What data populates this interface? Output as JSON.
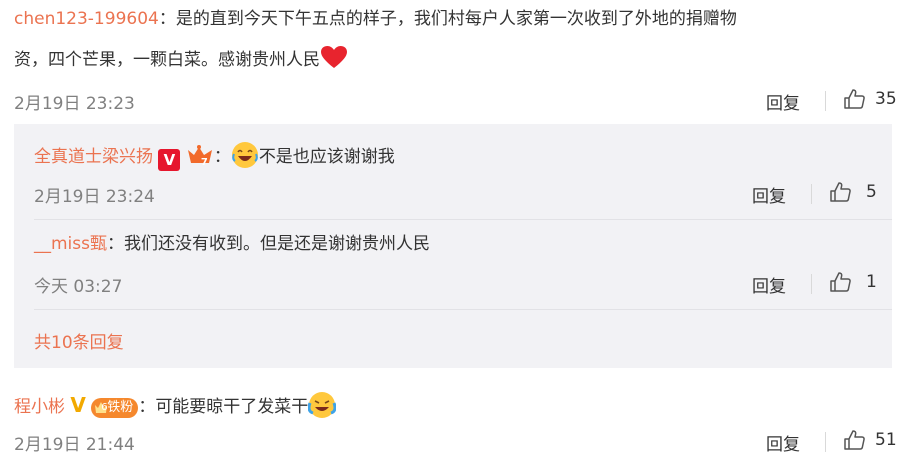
{
  "comments": [
    {
      "user": "chen123-199604",
      "separator": "：",
      "text_line1": "是的直到今天下午五点的样子，我们村每户人家第一次收到了外地的捐赠物",
      "text_line2": "资，四个芒果，一颗白菜。感谢贵州人民",
      "time": "2月19日 23:23",
      "reply_label": "回复",
      "likes": "35"
    },
    {
      "user": "程小彬",
      "separator": "：",
      "text": "可能要晾干了发菜干",
      "badge_level": "6",
      "badge_text": "铁粉",
      "time": "2月19日 21:44",
      "reply_label": "回复",
      "likes": "51"
    }
  ],
  "replies": [
    {
      "user": "全真道士梁兴扬",
      "separator": "：",
      "text": "不是也应该谢谢我",
      "vip_level": "7",
      "verified_badge": "V",
      "time": "2月19日 23:24",
      "reply_label": "回复",
      "likes": "5"
    },
    {
      "user": "__miss甄",
      "separator": "：",
      "text": "我们还没有收到。但是还是谢谢贵州人民",
      "time": "今天 03:27",
      "reply_label": "回复",
      "likes": "1"
    }
  ],
  "more_replies": "共10条回复",
  "colors": {
    "username": "#eb7350",
    "subbox_bg": "#f2f2f5",
    "verified_red": "#e6162d",
    "heart": "#e8242e"
  },
  "icons": [
    "thumbs-up-icon",
    "heart-icon",
    "verified-v-icon",
    "vip-crown-icon",
    "laugh-emoji",
    "crying-laugh-emoji"
  ]
}
